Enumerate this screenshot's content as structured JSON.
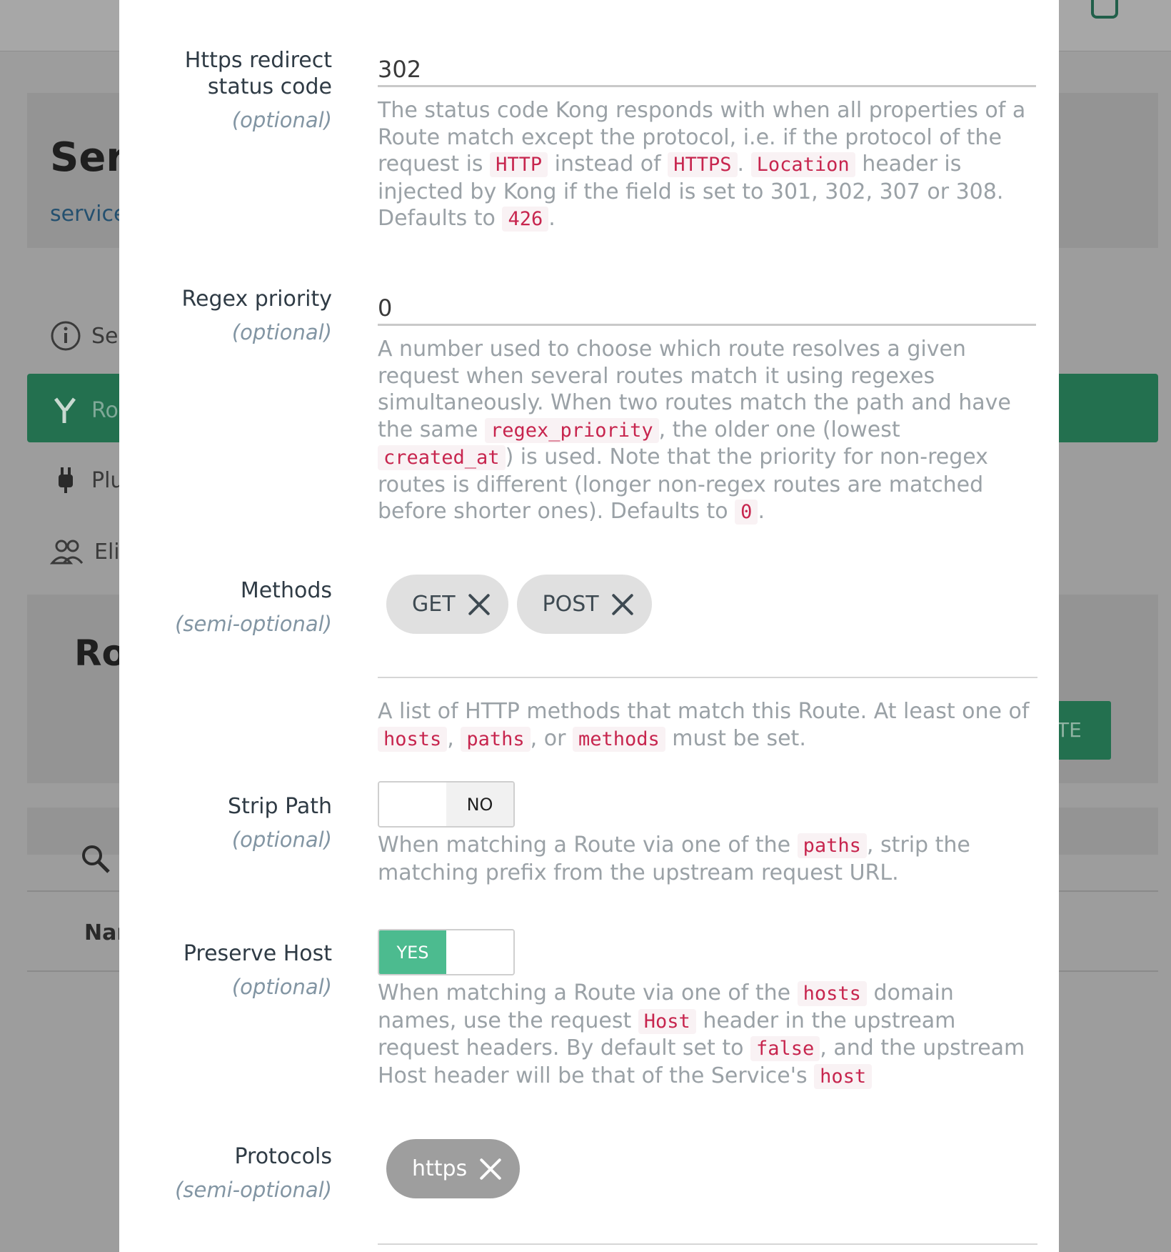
{
  "background": {
    "service_title": "Ser",
    "service_link": "service",
    "nav_items": [
      {
        "label": "Se",
        "icon": "info-icon"
      },
      {
        "label": "Ro",
        "icon": "routes-icon"
      },
      {
        "label": "Plu",
        "icon": "plug-icon"
      },
      {
        "label": "Eli",
        "icon": "users-icon"
      }
    ],
    "routes_title": "Ro",
    "create_button_label": "TE",
    "table_header_name": "Nar"
  },
  "form": {
    "https_redirect": {
      "label": "Https redirect status code",
      "optional": "(optional)",
      "value": "302",
      "help_1": "The status code Kong responds with when all properties of a Route match except the protocol, i.e. if the protocol of the request is ",
      "code_1": "HTTP",
      "help_2": " instead of ",
      "code_2": "HTTPS",
      "help_3": ". ",
      "code_3": "Location",
      "help_4": " header is injected by Kong if the field is set to 301, 302, 307 or 308. Defaults to ",
      "code_4": "426",
      "help_5": "."
    },
    "regex_priority": {
      "label": "Regex priority",
      "optional": "(optional)",
      "value": "0",
      "help_1": "A number used to choose which route resolves a given request when several routes match it using regexes simultaneously. When two routes match the path and have the same ",
      "code_1": "regex_priority",
      "help_2": ", the older one (lowest ",
      "code_2": "created_at",
      "help_3": ") is used. Note that the priority for non-regex routes is different (longer non-regex routes are matched before shorter ones). Defaults to ",
      "code_3": "0",
      "help_4": "."
    },
    "methods": {
      "label": "Methods",
      "optional": "(semi-optional)",
      "chips": [
        "GET",
        "POST"
      ],
      "help_1": "A list of HTTP methods that match this Route. At least one of ",
      "code_1": "hosts",
      "help_2": ", ",
      "code_2": "paths",
      "help_3": ", or ",
      "code_3": "methods",
      "help_4": " must be set."
    },
    "strip_path": {
      "label": "Strip Path",
      "optional": "(optional)",
      "toggle_label": "NO",
      "help_1": "When matching a Route via one of the ",
      "code_1": "paths",
      "help_2": ", strip the matching prefix from the upstream request URL."
    },
    "preserve_host": {
      "label": "Preserve Host",
      "optional": "(optional)",
      "toggle_label": "YES",
      "help_1": "When matching a Route via one of the ",
      "code_1": "hosts",
      "help_2": " domain names, use the request ",
      "code_2": "Host",
      "help_3": " header in the upstream request headers. By default set to ",
      "code_3": "false",
      "help_4": ", and the upstream Host header will be that of the Service's ",
      "code_4": "host"
    },
    "protocols": {
      "label": "Protocols",
      "optional": "(semi-optional)",
      "chips": [
        "https"
      ]
    }
  },
  "colors": {
    "accent_green": "#4cbb8f",
    "code_red": "#c7254e",
    "overlay": "#9d9d9d"
  }
}
